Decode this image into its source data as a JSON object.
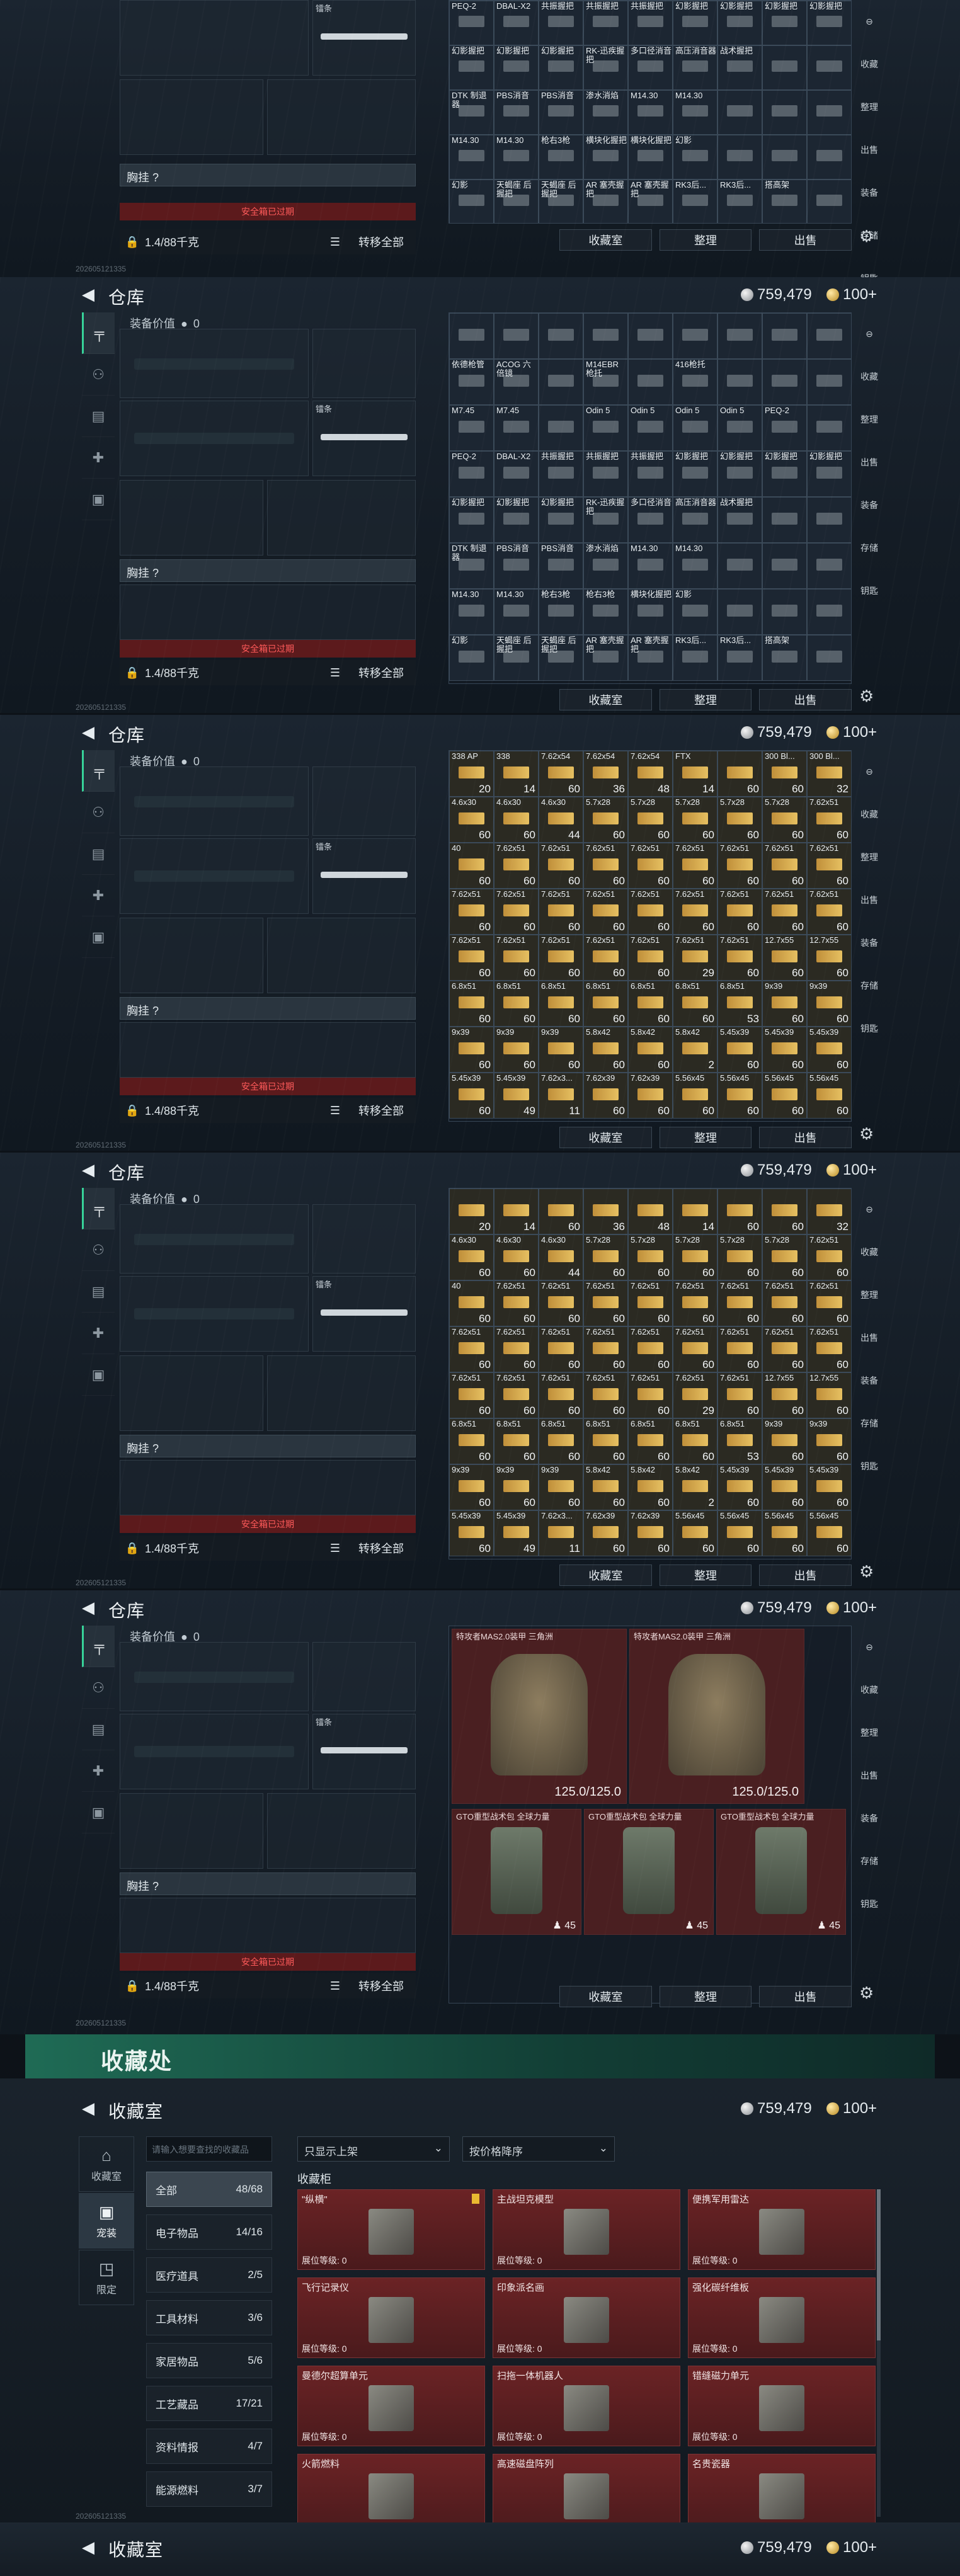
{
  "common": {
    "title": "仓库",
    "silver": "759,479",
    "gold": "100+",
    "equip_value_label": "装备价值",
    "equip_value": "0",
    "knife_label": "镭条",
    "chest_label": "胸挂 ?",
    "safe_expired": "安全箱已过期",
    "capacity": "1.4/88千克",
    "transfer_all": "转移全部",
    "btn_collection": "收藏室",
    "btn_sort": "整理",
    "btn_sell": "出售",
    "footer": "202605121335"
  },
  "side_icons": [
    "枪",
    "背包",
    "胸挂",
    "医疗",
    "箱"
  ],
  "right_icons": [
    "⊖",
    "收藏",
    "整理",
    "出售",
    "装备",
    "存储",
    "钥匙"
  ],
  "screen1_rows": [
    [
      [
        "PEQ-2",
        ""
      ],
      [
        "DBAL-X2",
        ""
      ],
      [
        "共振握把",
        ""
      ],
      [
        "共振握把",
        ""
      ],
      [
        "共振握把",
        ""
      ],
      [
        "幻影握把",
        ""
      ],
      [
        "幻影握把",
        ""
      ],
      [
        "幻影握把",
        ""
      ],
      [
        "幻影握把",
        ""
      ]
    ],
    [
      [
        "幻影握把",
        ""
      ],
      [
        "幻影握把",
        ""
      ],
      [
        "幻影握把",
        ""
      ],
      [
        "RK-迅疾握把",
        ""
      ],
      [
        "多口径消音",
        ""
      ],
      [
        "高压消音器",
        ""
      ],
      [
        "战术握把",
        ""
      ],
      [
        "",
        ""
      ],
      [
        "",
        ""
      ]
    ],
    [
      [
        "DTK 制退器",
        ""
      ],
      [
        "PBS消音",
        ""
      ],
      [
        "PBS消音",
        ""
      ],
      [
        "渗水消焰",
        ""
      ],
      [
        "M14.30",
        ""
      ],
      [
        "M14.30",
        ""
      ],
      [
        "",
        ""
      ],
      [
        "",
        ""
      ],
      [
        "",
        ""
      ]
    ],
    [
      [
        "M14.30",
        ""
      ],
      [
        "M14.30",
        ""
      ],
      [
        "枪右3枪",
        ""
      ],
      [
        "横块化握把",
        ""
      ],
      [
        "横块化握把",
        ""
      ],
      [
        "幻影",
        ""
      ],
      [
        "",
        ""
      ],
      [
        "",
        ""
      ],
      [
        "",
        ""
      ]
    ],
    [
      [
        "幻影",
        ""
      ],
      [
        "天蝎座 后握把",
        ""
      ],
      [
        "天蝎座 后握把",
        ""
      ],
      [
        "AR 塞壳握把",
        ""
      ],
      [
        "AR 塞壳握把",
        ""
      ],
      [
        "RK3后...",
        ""
      ],
      [
        "RK3后...",
        ""
      ],
      [
        "搭高架",
        ""
      ],
      [
        "",
        ""
      ]
    ]
  ],
  "screen2_rows": [
    [
      [
        "",
        ""
      ],
      [
        "",
        ""
      ],
      [
        "",
        ""
      ],
      [
        "",
        ""
      ],
      [
        "",
        ""
      ],
      [
        "",
        ""
      ],
      [
        "",
        ""
      ],
      [
        "",
        ""
      ],
      [
        "",
        ""
      ]
    ],
    [
      [
        "依德枪管",
        ""
      ],
      [
        "ACOG 六倍镜",
        ""
      ],
      [
        "",
        ""
      ],
      [
        "M14EBR 枪托",
        ""
      ],
      [
        "",
        ""
      ],
      [
        "416枪托",
        ""
      ],
      [
        "",
        ""
      ],
      [
        "",
        ""
      ],
      [
        "",
        ""
      ]
    ],
    [
      [
        "M7.45",
        ""
      ],
      [
        "M7.45",
        ""
      ],
      [
        "",
        ""
      ],
      [
        "Odin 5",
        ""
      ],
      [
        "Odin 5",
        ""
      ],
      [
        "Odin 5",
        ""
      ],
      [
        "Odin 5",
        ""
      ],
      [
        "PEQ-2",
        ""
      ],
      [
        "",
        ""
      ]
    ],
    [
      [
        "PEQ-2",
        ""
      ],
      [
        "DBAL-X2",
        ""
      ],
      [
        "共振握把",
        ""
      ],
      [
        "共振握把",
        ""
      ],
      [
        "共振握把",
        ""
      ],
      [
        "幻影握把",
        ""
      ],
      [
        "幻影握把",
        ""
      ],
      [
        "幻影握把",
        ""
      ],
      [
        "幻影握把",
        ""
      ]
    ],
    [
      [
        "幻影握把",
        ""
      ],
      [
        "幻影握把",
        ""
      ],
      [
        "幻影握把",
        ""
      ],
      [
        "RK-迅疾握把",
        ""
      ],
      [
        "多口径消音",
        ""
      ],
      [
        "高压消音器",
        ""
      ],
      [
        "战术握把",
        ""
      ],
      [
        "",
        ""
      ],
      [
        "",
        ""
      ]
    ],
    [
      [
        "DTK 制退器",
        ""
      ],
      [
        "PBS消音",
        ""
      ],
      [
        "PBS消音",
        ""
      ],
      [
        "渗水消焰",
        ""
      ],
      [
        "M14.30",
        ""
      ],
      [
        "M14.30",
        ""
      ],
      [
        "",
        ""
      ],
      [
        "",
        ""
      ],
      [
        "",
        ""
      ]
    ],
    [
      [
        "M14.30",
        ""
      ],
      [
        "M14.30",
        ""
      ],
      [
        "枪右3枪",
        ""
      ],
      [
        "枪右3枪",
        ""
      ],
      [
        "横块化握把",
        ""
      ],
      [
        "幻影",
        ""
      ],
      [
        "",
        ""
      ],
      [
        "",
        ""
      ],
      [
        "",
        ""
      ]
    ],
    [
      [
        "幻影",
        ""
      ],
      [
        "天蝎座 后握把",
        ""
      ],
      [
        "天蝎座 后握把",
        ""
      ],
      [
        "AR 塞壳握把",
        ""
      ],
      [
        "AR 塞壳握把",
        ""
      ],
      [
        "RK3后...",
        ""
      ],
      [
        "RK3后...",
        ""
      ],
      [
        "搭高架",
        ""
      ],
      [
        "",
        ""
      ]
    ]
  ],
  "screen3_rows": [
    [
      [
        "338 AP",
        "20"
      ],
      [
        "338",
        "14"
      ],
      [
        "7.62x54",
        "60"
      ],
      [
        "7.62x54",
        "36"
      ],
      [
        "7.62x54",
        "48"
      ],
      [
        "FTX",
        "14"
      ],
      [
        "",
        "60"
      ],
      [
        "300 Bl...",
        "60"
      ],
      [
        "300 Bl...",
        "32"
      ]
    ],
    [
      [
        "4.6x30",
        "60"
      ],
      [
        "4.6x30",
        "60"
      ],
      [
        "4.6x30",
        "44"
      ],
      [
        "5.7x28",
        "60"
      ],
      [
        "5.7x28",
        "60"
      ],
      [
        "5.7x28",
        "60"
      ],
      [
        "5.7x28",
        "60"
      ],
      [
        "5.7x28",
        "60"
      ],
      [
        "7.62x51",
        "60"
      ]
    ],
    [
      [
        "40",
        "60"
      ],
      [
        "7.62x51",
        "60"
      ],
      [
        "7.62x51",
        "60"
      ],
      [
        "7.62x51",
        "60"
      ],
      [
        "7.62x51",
        "60"
      ],
      [
        "7.62x51",
        "60"
      ],
      [
        "7.62x51",
        "60"
      ],
      [
        "7.62x51",
        "60"
      ],
      [
        "7.62x51",
        "60"
      ]
    ],
    [
      [
        "7.62x51",
        "60"
      ],
      [
        "7.62x51",
        "60"
      ],
      [
        "7.62x51",
        "60"
      ],
      [
        "7.62x51",
        "60"
      ],
      [
        "7.62x51",
        "60"
      ],
      [
        "7.62x51",
        "60"
      ],
      [
        "7.62x51",
        "60"
      ],
      [
        "7.62x51",
        "60"
      ],
      [
        "7.62x51",
        "60"
      ]
    ],
    [
      [
        "7.62x51",
        "60"
      ],
      [
        "7.62x51",
        "60"
      ],
      [
        "7.62x51",
        "60"
      ],
      [
        "7.62x51",
        "60"
      ],
      [
        "7.62x51",
        "60"
      ],
      [
        "7.62x51",
        "29"
      ],
      [
        "7.62x51",
        "60"
      ],
      [
        "12.7x55",
        "60"
      ],
      [
        "12.7x55",
        "60"
      ]
    ],
    [
      [
        "6.8x51",
        "60"
      ],
      [
        "6.8x51",
        "60"
      ],
      [
        "6.8x51",
        "60"
      ],
      [
        "6.8x51",
        "60"
      ],
      [
        "6.8x51",
        "60"
      ],
      [
        "6.8x51",
        "60"
      ],
      [
        "6.8x51",
        "53"
      ],
      [
        "9x39",
        "60"
      ],
      [
        "9x39",
        "60"
      ]
    ],
    [
      [
        "9x39",
        "60"
      ],
      [
        "9x39",
        "60"
      ],
      [
        "9x39",
        "60"
      ],
      [
        "5.8x42",
        "60"
      ],
      [
        "5.8x42",
        "60"
      ],
      [
        "5.8x42",
        "2"
      ],
      [
        "5.45x39",
        "60"
      ],
      [
        "5.45x39",
        "60"
      ],
      [
        "5.45x39",
        "60"
      ]
    ],
    [
      [
        "5.45x39",
        "60"
      ],
      [
        "5.45x39",
        "49"
      ],
      [
        "7.62x3...",
        "11"
      ],
      [
        "7.62x39",
        "60"
      ],
      [
        "7.62x39",
        "60"
      ],
      [
        "5.56x45",
        "60"
      ],
      [
        "5.56x45",
        "60"
      ],
      [
        "5.56x45",
        "60"
      ],
      [
        "5.56x45",
        "60"
      ]
    ]
  ],
  "screen4_rows": [
    [
      [
        "",
        "20"
      ],
      [
        "",
        "14"
      ],
      [
        "",
        "60"
      ],
      [
        "",
        "36"
      ],
      [
        "",
        "48"
      ],
      [
        "",
        "14"
      ],
      [
        "",
        "60"
      ],
      [
        "",
        "60"
      ],
      [
        "",
        "32"
      ]
    ],
    [
      [
        "4.6x30",
        "60"
      ],
      [
        "4.6x30",
        "60"
      ],
      [
        "4.6x30",
        "44"
      ],
      [
        "5.7x28",
        "60"
      ],
      [
        "5.7x28",
        "60"
      ],
      [
        "5.7x28",
        "60"
      ],
      [
        "5.7x28",
        "60"
      ],
      [
        "5.7x28",
        "60"
      ],
      [
        "7.62x51",
        "60"
      ]
    ],
    [
      [
        "40",
        "60"
      ],
      [
        "7.62x51",
        "60"
      ],
      [
        "7.62x51",
        "60"
      ],
      [
        "7.62x51",
        "60"
      ],
      [
        "7.62x51",
        "60"
      ],
      [
        "7.62x51",
        "60"
      ],
      [
        "7.62x51",
        "60"
      ],
      [
        "7.62x51",
        "60"
      ],
      [
        "7.62x51",
        "60"
      ]
    ],
    [
      [
        "7.62x51",
        "60"
      ],
      [
        "7.62x51",
        "60"
      ],
      [
        "7.62x51",
        "60"
      ],
      [
        "7.62x51",
        "60"
      ],
      [
        "7.62x51",
        "60"
      ],
      [
        "7.62x51",
        "60"
      ],
      [
        "7.62x51",
        "60"
      ],
      [
        "7.62x51",
        "60"
      ],
      [
        "7.62x51",
        "60"
      ]
    ],
    [
      [
        "7.62x51",
        "60"
      ],
      [
        "7.62x51",
        "60"
      ],
      [
        "7.62x51",
        "60"
      ],
      [
        "7.62x51",
        "60"
      ],
      [
        "7.62x51",
        "60"
      ],
      [
        "7.62x51",
        "29"
      ],
      [
        "7.62x51",
        "60"
      ],
      [
        "12.7x55",
        "60"
      ],
      [
        "12.7x55",
        "60"
      ]
    ],
    [
      [
        "6.8x51",
        "60"
      ],
      [
        "6.8x51",
        "60"
      ],
      [
        "6.8x51",
        "60"
      ],
      [
        "6.8x51",
        "60"
      ],
      [
        "6.8x51",
        "60"
      ],
      [
        "6.8x51",
        "60"
      ],
      [
        "6.8x51",
        "53"
      ],
      [
        "9x39",
        "60"
      ],
      [
        "9x39",
        "60"
      ]
    ],
    [
      [
        "9x39",
        "60"
      ],
      [
        "9x39",
        "60"
      ],
      [
        "9x39",
        "60"
      ],
      [
        "5.8x42",
        "60"
      ],
      [
        "5.8x42",
        "60"
      ],
      [
        "5.8x42",
        "2"
      ],
      [
        "5.45x39",
        "60"
      ],
      [
        "5.45x39",
        "60"
      ],
      [
        "5.45x39",
        "60"
      ]
    ],
    [
      [
        "5.45x39",
        "60"
      ],
      [
        "5.45x39",
        "49"
      ],
      [
        "7.62x3...",
        "11"
      ],
      [
        "7.62x39",
        "60"
      ],
      [
        "7.62x39",
        "60"
      ],
      [
        "5.56x45",
        "60"
      ],
      [
        "5.56x45",
        "60"
      ],
      [
        "5.56x45",
        "60"
      ],
      [
        "5.56x45",
        "60"
      ]
    ]
  ],
  "armor": [
    {
      "name": "特攻者MAS2.0装甲 三角洲",
      "dur": "125.0/125.0"
    },
    {
      "name": "特攻者MAS2.0装甲 三角洲",
      "dur": "125.0/125.0"
    }
  ],
  "packs": [
    {
      "name": "GTO重型战术包 全球力量",
      "lvl": "45"
    },
    {
      "name": "GTO重型战术包 全球力量",
      "lvl": "45"
    },
    {
      "name": "GTO重型战术包 全球力量",
      "lvl": "45"
    }
  ],
  "collection": {
    "banner": "收藏处",
    "title": "收藏室",
    "tabs": [
      {
        "icon": "⌂",
        "label": "收藏室"
      },
      {
        "icon": "▣",
        "label": "宠装"
      },
      {
        "icon": "◳",
        "label": "限定"
      }
    ],
    "search_placeholder": "请输入想要查找的收藏品",
    "filter": "只显示上架",
    "sort": "按价格降序",
    "box_title": "收藏柜",
    "categories": [
      {
        "name": "全部",
        "count": "48/68"
      },
      {
        "name": "电子物品",
        "count": "14/16"
      },
      {
        "name": "医疗道具",
        "count": "2/5"
      },
      {
        "name": "工具材料",
        "count": "3/6"
      },
      {
        "name": "家居物品",
        "count": "5/6"
      },
      {
        "name": "工艺藏品",
        "count": "17/21"
      },
      {
        "name": "资料情报",
        "count": "4/7"
      },
      {
        "name": "能源燃料",
        "count": "3/7"
      }
    ],
    "level_label": "展位等级: 0",
    "items": [
      "\"纵横\"",
      "主战坦克模型",
      "便携军用雷达",
      "飞行记录仪",
      "印象派名画",
      "强化碳纤维板",
      "曼德尔超算单元",
      "扫拖一体机器人",
      "错缝磁力单元",
      "火箭燃料",
      "高速磁盘阵列",
      "名贵瓷器"
    ]
  }
}
